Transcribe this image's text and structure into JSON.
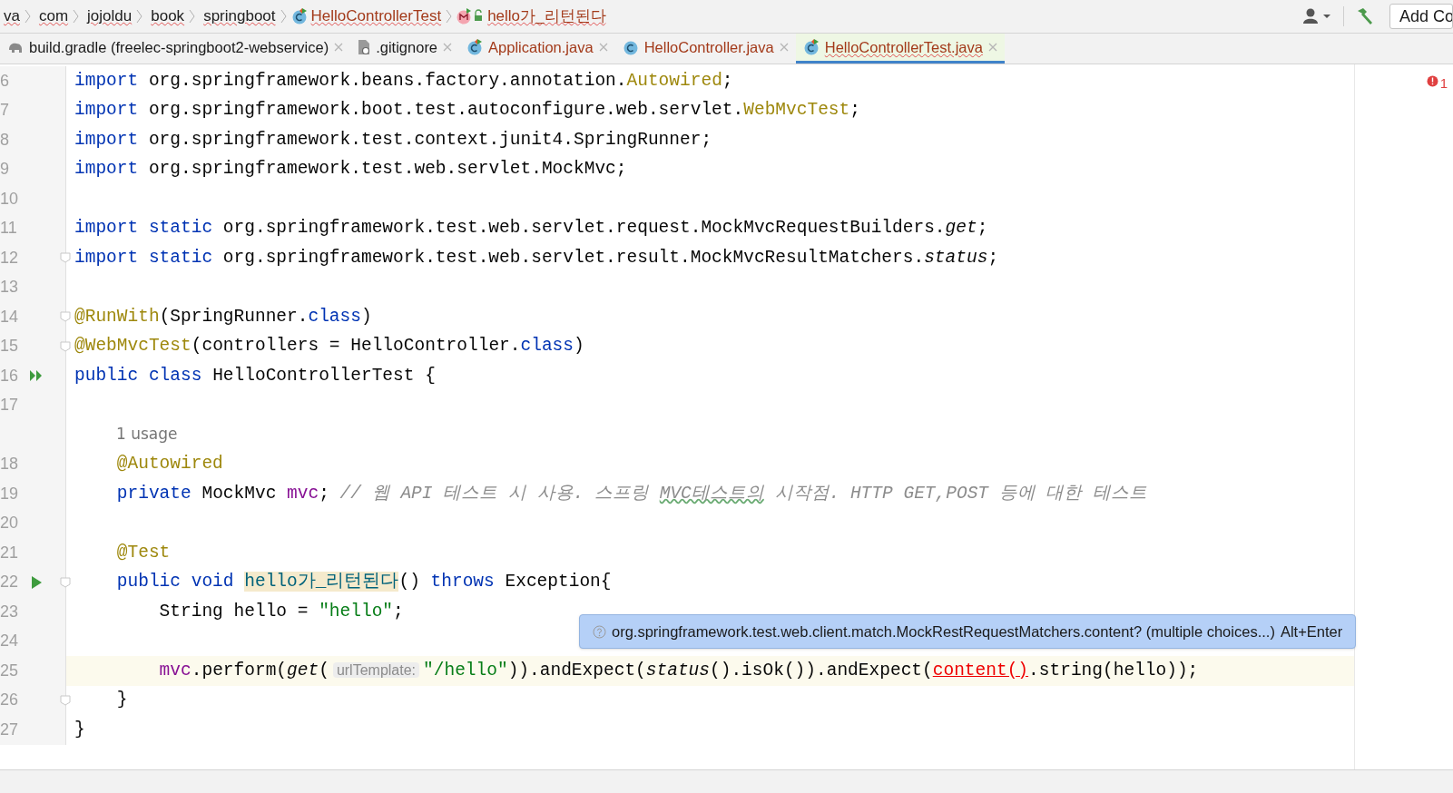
{
  "breadcrumbs": [
    {
      "label": "va",
      "kind": "folder"
    },
    {
      "label": "com",
      "kind": "folder"
    },
    {
      "label": "jojoldu",
      "kind": "folder"
    },
    {
      "label": "book",
      "kind": "folder"
    },
    {
      "label": "springboot",
      "kind": "folder"
    },
    {
      "label": "HelloControllerTest",
      "kind": "class"
    },
    {
      "label": "hello가_리턴된다",
      "kind": "method"
    }
  ],
  "toolbar": {
    "button": "Add Co"
  },
  "tabs": [
    {
      "label": "build.gradle (freelec-springboot2-webservice)",
      "kind": "gradle",
      "selected": false
    },
    {
      "label": ".gitignore",
      "kind": "ignore",
      "selected": false
    },
    {
      "label": "Application.java",
      "kind": "runnable",
      "selected": false
    },
    {
      "label": "HelloController.java",
      "kind": "class",
      "selected": false
    },
    {
      "label": "HelloControllerTest.java",
      "kind": "runnable",
      "selected": true
    }
  ],
  "error_count": "1",
  "lines": [
    {
      "number": "6",
      "current": false,
      "fold": false,
      "tokens": [
        {
          "kind": "kw",
          "text": "import"
        },
        {
          "kind": "plain",
          "text": " org.springframework.beans.factory.annotation."
        },
        {
          "kind": "ann",
          "text": "Autowired"
        },
        {
          "kind": "plain",
          "text": ";"
        }
      ]
    },
    {
      "number": "7",
      "current": false,
      "fold": false,
      "tokens": [
        {
          "kind": "kw",
          "text": "import"
        },
        {
          "kind": "plain",
          "text": " org.springframework.boot.test.autoconfigure.web.servlet."
        },
        {
          "kind": "ann",
          "text": "WebMvcTest"
        },
        {
          "kind": "plain",
          "text": ";"
        }
      ]
    },
    {
      "number": "8",
      "current": false,
      "fold": false,
      "tokens": [
        {
          "kind": "kw",
          "text": "import"
        },
        {
          "kind": "plain",
          "text": " org.springframework.test.context.junit4.SpringRunner;"
        }
      ]
    },
    {
      "number": "9",
      "current": false,
      "fold": false,
      "tokens": [
        {
          "kind": "kw",
          "text": "import"
        },
        {
          "kind": "plain",
          "text": " org.springframework.test.web.servlet.MockMvc;"
        }
      ]
    },
    {
      "number": "10",
      "current": false,
      "fold": false
    },
    {
      "number": "11",
      "current": false,
      "fold": false,
      "tokens": [
        {
          "kind": "kw",
          "text": "import static"
        },
        {
          "kind": "plain",
          "text": " org.springframework.test.web.servlet.request.MockMvcRequestBuilders."
        },
        {
          "kind": "italic",
          "text": "get"
        },
        {
          "kind": "plain",
          "text": ";"
        }
      ]
    },
    {
      "number": "12",
      "current": false,
      "fold": true,
      "tokens": [
        {
          "kind": "kw",
          "text": "import static"
        },
        {
          "kind": "plain",
          "text": " org.springframework.test.web.servlet.result.MockMvcResultMatchers."
        },
        {
          "kind": "italic",
          "text": "status"
        },
        {
          "kind": "plain",
          "text": ";"
        }
      ]
    },
    {
      "number": "13",
      "current": false,
      "fold": false
    },
    {
      "number": "14",
      "current": false,
      "fold": true,
      "tokens": [
        {
          "kind": "ann",
          "text": "@RunWith"
        },
        {
          "kind": "plain",
          "text": "(SpringRunner."
        },
        {
          "kind": "kw",
          "text": "class"
        },
        {
          "kind": "plain",
          "text": ")"
        }
      ]
    },
    {
      "number": "15",
      "current": false,
      "fold": true,
      "tokens": [
        {
          "kind": "ann",
          "text": "@WebMvcTest"
        },
        {
          "kind": "plain",
          "text": "(controllers = HelloController."
        },
        {
          "kind": "kw",
          "text": "class"
        },
        {
          "kind": "plain",
          "text": ")"
        }
      ]
    },
    {
      "number": "16",
      "current": false,
      "fold": false,
      "gutter_icon": {
        "kind": "run-all"
      },
      "tokens": [
        {
          "kind": "kw",
          "text": "public class"
        },
        {
          "kind": "plain",
          "text": " HelloControllerTest {"
        }
      ]
    },
    {
      "number": "17",
      "current": false,
      "fold": false
    },
    {
      "current": false,
      "fold": false,
      "tokens": [
        {
          "kind": "inlay",
          "text": "1 usage"
        }
      ]
    },
    {
      "number": "18",
      "current": false,
      "fold": false,
      "tokens": [
        {
          "kind": "ann",
          "text": "    @Autowired"
        }
      ]
    },
    {
      "number": "19",
      "current": false,
      "fold": false,
      "tokens": [
        {
          "kind": "kw",
          "text": "    private"
        },
        {
          "kind": "plain",
          "text": " MockMvc "
        },
        {
          "kind": "field",
          "text": "mvc"
        },
        {
          "kind": "plain",
          "text": "; "
        },
        {
          "kind": "comment",
          "text": "// 웹 API 테스트 시 사용. 스프링 "
        },
        {
          "kind": "typo",
          "text": "MVC테스트의"
        },
        {
          "kind": "comment",
          "text": " 시작점. HTTP GET,POST 등에 대한 테스트"
        }
      ]
    },
    {
      "number": "20",
      "current": false,
      "fold": false
    },
    {
      "number": "21",
      "current": false,
      "fold": false,
      "tokens": [
        {
          "kind": "ann",
          "text": "    @Test"
        }
      ]
    },
    {
      "number": "22",
      "current": false,
      "fold": true,
      "gutter_icon": {
        "kind": "run"
      },
      "tokens": [
        {
          "kind": "kw",
          "text": "    public void "
        },
        {
          "kind": "highlight",
          "text": "hello가_리턴된다"
        },
        {
          "kind": "plain",
          "text": "() "
        },
        {
          "kind": "kw",
          "text": "throws"
        },
        {
          "kind": "plain",
          "text": " Exception{"
        }
      ]
    },
    {
      "number": "23",
      "current": false,
      "fold": false,
      "tokens": [
        {
          "kind": "plain",
          "text": "        String hello = "
        },
        {
          "kind": "string",
          "text": "\"hello\""
        },
        {
          "kind": "plain",
          "text": ";"
        }
      ]
    },
    {
      "number": "24",
      "current": false,
      "fold": false
    },
    {
      "number": "25",
      "current": true,
      "fold": false,
      "tokens": [
        {
          "kind": "field",
          "text": "        mvc"
        },
        {
          "kind": "plain",
          "text": ".perform("
        },
        {
          "kind": "italic",
          "text": "get"
        },
        {
          "kind": "plain",
          "text": "("
        },
        {
          "kind": "hint",
          "text": "urlTemplate:"
        },
        {
          "kind": "string",
          "text": "\"/hello\""
        },
        {
          "kind": "plain",
          "text": ")).andExpect("
        },
        {
          "kind": "italic",
          "text": "status"
        },
        {
          "kind": "plain",
          "text": "().isOk()).andExpect("
        },
        {
          "kind": "error",
          "text": "content()"
        },
        {
          "kind": "plain",
          "text": ".string(hello));"
        }
      ]
    },
    {
      "number": "26",
      "current": false,
      "fold": true,
      "tokens": [
        {
          "kind": "plain",
          "text": "    }"
        }
      ]
    },
    {
      "number": "27",
      "current": false,
      "fold": false,
      "tokens": [
        {
          "kind": "plain",
          "text": "}"
        }
      ]
    }
  ],
  "tooltip": {
    "text": "org.springframework.test.web.client.match.MockRestRequestMatchers.content? (multiple choices...)",
    "shortcut": "Alt+Enter"
  }
}
